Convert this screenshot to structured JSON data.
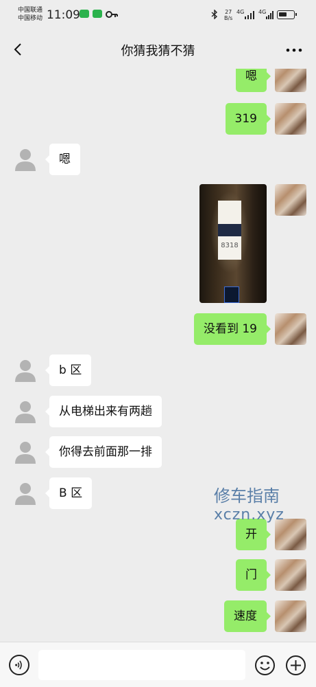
{
  "status_bar": {
    "carrier_1": "中国联通",
    "carrier_2": "中国移动",
    "time": "11:09",
    "net_speed_value": "27",
    "net_speed_unit": "B/s",
    "signal_1": "4G",
    "signal_2": "4G",
    "battery_level": 0.6
  },
  "header": {
    "title": "你猜我猜不猜"
  },
  "messages": [
    {
      "side": "self",
      "text": "嗯"
    },
    {
      "side": "self",
      "text": "319"
    },
    {
      "side": "other",
      "text": "嗯"
    },
    {
      "side": "self",
      "type": "image",
      "photo_number": "8318"
    },
    {
      "side": "self",
      "text": "没看到 19"
    },
    {
      "side": "other",
      "text": "b 区"
    },
    {
      "side": "other",
      "text": "从电梯出来有两趟"
    },
    {
      "side": "other",
      "text": "你得去前面那一排"
    },
    {
      "side": "other",
      "text": "B 区"
    },
    {
      "side": "self",
      "text": "开"
    },
    {
      "side": "self",
      "text": "门"
    },
    {
      "side": "self",
      "text": "速度"
    }
  ],
  "watermark": {
    "line1": "修车指南",
    "line2": "xczn.xyz"
  },
  "input_bar": {
    "value": "",
    "placeholder": ""
  },
  "colors": {
    "background": "#ededed",
    "self_bubble": "#95ec69",
    "other_bubble": "#ffffff"
  }
}
